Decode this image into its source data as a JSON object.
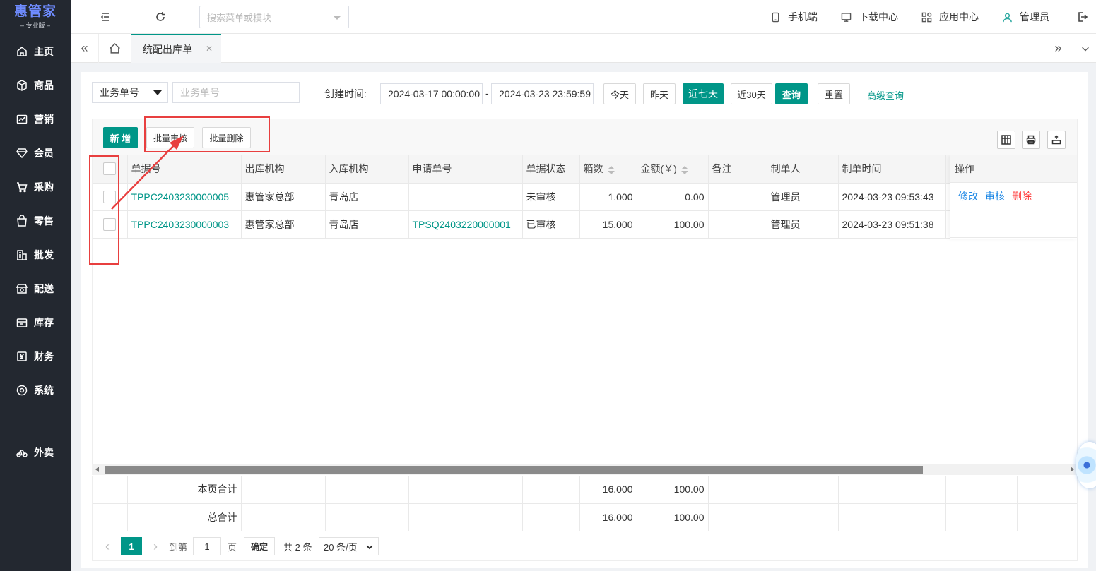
{
  "brand": {
    "name": "惠管家",
    "edition": "专业版"
  },
  "sidebar": {
    "items": [
      {
        "label": "主页",
        "icon": "home-icon"
      },
      {
        "label": "商品",
        "icon": "box-icon"
      },
      {
        "label": "营销",
        "icon": "chart-icon"
      },
      {
        "label": "会员",
        "icon": "diamond-icon"
      },
      {
        "label": "采购",
        "icon": "cart-icon"
      },
      {
        "label": "零售",
        "icon": "bag-icon"
      },
      {
        "label": "批发",
        "icon": "building-icon"
      },
      {
        "label": "配送",
        "icon": "store-icon"
      },
      {
        "label": "库存",
        "icon": "inventory-icon"
      },
      {
        "label": "财务",
        "icon": "yen-icon"
      },
      {
        "label": "系统",
        "icon": "settings-icon"
      },
      {
        "label": "外卖",
        "icon": "bike-icon"
      }
    ]
  },
  "topbar": {
    "search_placeholder": "搜索菜单或模块",
    "mobile": "手机端",
    "download": "下载中心",
    "apps": "应用中心",
    "user": "管理员"
  },
  "tabs": {
    "active": "统配出库单"
  },
  "filters": {
    "field_select": "业务单号",
    "field_placeholder": "业务单号",
    "created_label": "创建时间:",
    "start": "2024-03-17 00:00:00",
    "sep": "-",
    "end": "2024-03-23 23:59:59",
    "today": "今天",
    "yesterday": "昨天",
    "last7": "近七天",
    "last30": "近30天",
    "query": "查询",
    "reset": "重置",
    "advanced": "高级查询"
  },
  "toolbar": {
    "add": "新 增",
    "batch_audit": "批量审核",
    "batch_delete": "批量删除"
  },
  "table": {
    "headers": {
      "order_no": "单据号",
      "out_org": "出库机构",
      "in_org": "入库机构",
      "apply_no": "申请单号",
      "status": "单据状态",
      "boxes": "箱数",
      "amount": "金额(￥)",
      "remark": "备注",
      "maker": "制单人",
      "make_time": "制单时间",
      "ops": "操作"
    },
    "rows": [
      {
        "order_no": "TPPC2403230000005",
        "out_org": "惠管家总部",
        "in_org": "青岛店",
        "apply_no": "",
        "status": "未审核",
        "boxes": "1.000",
        "amount": "0.00",
        "remark": "",
        "maker": "管理员",
        "make_time": "2024-03-23 09:53:43",
        "ops": [
          "修改",
          "审核",
          "删除"
        ]
      },
      {
        "order_no": "TPPC2403230000003",
        "out_org": "惠管家总部",
        "in_org": "青岛店",
        "apply_no": "TPSQ2403220000001",
        "status": "已审核",
        "boxes": "15.000",
        "amount": "100.00",
        "remark": "",
        "maker": "管理员",
        "make_time": "2024-03-23 09:51:38",
        "ops": []
      }
    ]
  },
  "totals": {
    "page_label": "本页合计",
    "page_boxes": "16.000",
    "page_amount": "100.00",
    "all_label": "总合计",
    "all_boxes": "16.000",
    "all_amount": "100.00"
  },
  "pagination": {
    "current": "1",
    "goto_label": "到第",
    "goto_value": "1",
    "page_unit": "页",
    "confirm": "确定",
    "total": "共 2 条",
    "page_size": "20 条/页"
  },
  "colors": {
    "sidebar_bg": "#232830",
    "primary": "#009688",
    "link": "#1e88e5",
    "danger": "#ff3b3b",
    "annotation": "#e83f3f"
  }
}
